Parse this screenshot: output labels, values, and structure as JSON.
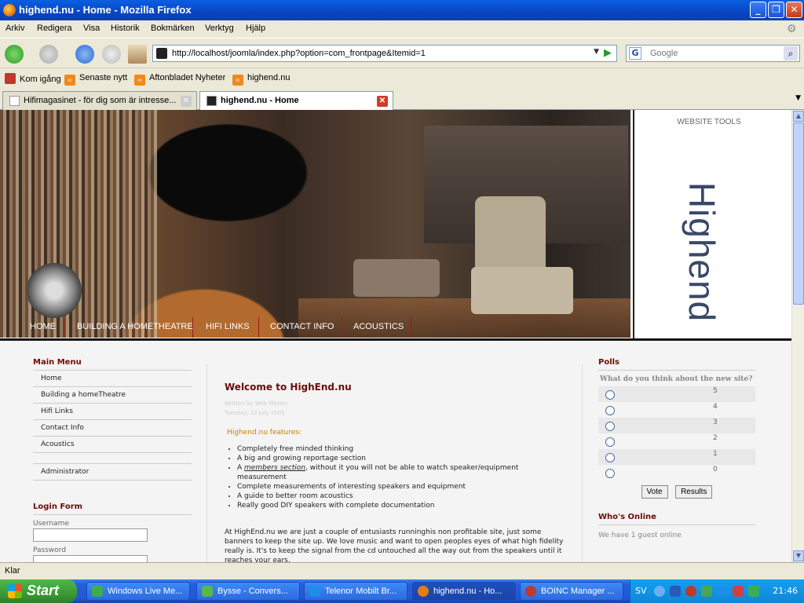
{
  "window": {
    "title": "highend.nu - Home - Mozilla Firefox"
  },
  "menu": [
    "Arkiv",
    "Redigera",
    "Visa",
    "Historik",
    "Bokmärken",
    "Verktyg",
    "Hjälp"
  ],
  "url": "http://localhost/joomla/index.php?option=com_frontpage&Itemid=1",
  "search_placeholder": "Google",
  "bookmarks": [
    "Kom igång",
    "Senaste nytt",
    "Aftonbladet Nyheter",
    "highend.nu"
  ],
  "tabs": [
    {
      "label": "Hifimagasinet - för dig som är intresse...",
      "active": false
    },
    {
      "label": "highend.nu - Home",
      "active": true
    }
  ],
  "site": {
    "nav": [
      "HOME",
      "BUILDING A HOMETHEATRE",
      "HIFI LINKS",
      "CONTACT INFO",
      "ACOUSTICS"
    ],
    "tools_title": "WEBSITE TOOLS",
    "logo_text": "Highend",
    "main_menu_title": "Main Menu",
    "main_menu": [
      "Home",
      "Building a homeTheatre",
      "Hifi Links",
      "Contact Info",
      "Acoustics"
    ],
    "admin_link": "Administrator",
    "login_title": "Login Form",
    "username_label": "Username",
    "password_label": "Password",
    "article": {
      "title": "Welcome to HighEnd.nu",
      "author": "Written by Web Master",
      "date": "Tuesday, 12 July 2005",
      "features_heading": "Highend.nu features:",
      "feature_1": "Completely free minded thinking",
      "feature_2": "A big and growing reportage section",
      "feature_3_pre": "A ",
      "feature_3_link": "members section",
      "feature_3_post": ", without it you will not be able to watch speaker/equipment measurement",
      "feature_4": "Complete measurements of interesting speakers and equipment",
      "feature_5": "A guide to better room acoustics",
      "feature_6": "Really good DIY speakers with complete documentation",
      "paragraph": "At HighEnd.nu we are just a couple of entusiasts runninghis non profitable site, just some banners to keep the site up. We love music and want to open peoples eyes of what high fidelity really is. It's to keep the signal from the cd untouched all the way out from the speakers until it reaches your ears."
    },
    "polls_title": "Polls",
    "poll_question": "What do you think about the new site?",
    "poll_options": [
      "5",
      "4",
      "3",
      "2",
      "1",
      "0"
    ],
    "vote_label": "Vote",
    "results_label": "Results",
    "online_title": "Who's Online",
    "online_text": "We have 1 guest online"
  },
  "status": "Klar",
  "taskbar": {
    "start": "Start",
    "items": [
      {
        "label": "Windows Live Me...",
        "color": "#3fae4a",
        "active": false
      },
      {
        "label": "Bysse - Convers...",
        "color": "#58b848",
        "active": false
      },
      {
        "label": "Telenor Mobilt Br...",
        "color": "#1d8ee8",
        "active": false
      },
      {
        "label": "highend.nu - Ho...",
        "color": "#e87b12",
        "active": true
      },
      {
        "label": "BOINC Manager ...",
        "color": "#c0392b",
        "active": false
      }
    ],
    "lang": "SV",
    "clock": "21:46"
  }
}
